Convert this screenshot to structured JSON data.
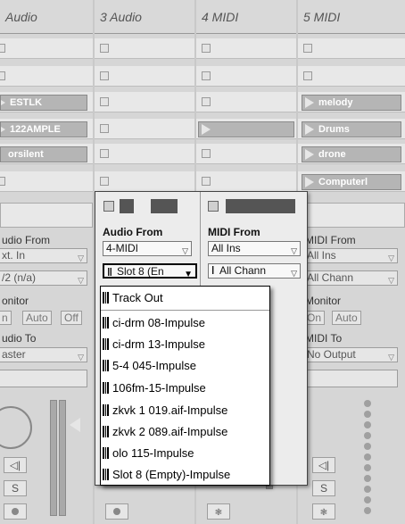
{
  "tracks": [
    {
      "name": "Audio"
    },
    {
      "name": "3 Audio"
    },
    {
      "name": "4 MIDI"
    },
    {
      "name": "5 MIDI"
    }
  ],
  "clips": {
    "col1": [
      "ESTLK",
      "122AMPLE",
      "orsilent"
    ],
    "col4": [
      "melody",
      "Drums",
      "drone",
      "Computerl"
    ]
  },
  "io": {
    "col1": {
      "from_label": "udio From",
      "from_value": "xt. In",
      "channel_value": "/2 (n/a)",
      "monitor_label": "onitor",
      "monitor_buttons": [
        "n",
        "Auto",
        "Off"
      ],
      "to_label": "udio To",
      "to_value": "aster"
    },
    "col4": {
      "from_label": "MIDI From",
      "from_value": "All Ins",
      "channel_value": "All Chann",
      "monitor_label": "Monitor",
      "monitor_buttons": [
        "On",
        "Auto"
      ],
      "to_label": "MIDI To",
      "to_value": "No Output"
    }
  },
  "panel": {
    "audio_from_label": "Audio From",
    "audio_from_value": "4-MIDI",
    "slot_value": "Slot 8 (En",
    "midi_from_label": "MIDI From",
    "midi_from_value": "All Ins",
    "midi_channel_value": "All Chann"
  },
  "menu": {
    "items": [
      "Track Out",
      "ci-drm 08-Impulse",
      "ci-drm 13-Impulse",
      "5-4 045-Impulse",
      "106fm-15-Impulse",
      "zkvk 1 019.aif-Impulse",
      "zkvk 2 089.aif-Impulse",
      "olo 115-Impulse",
      "Slot 8 (Empty)-Impulse"
    ]
  },
  "mixer": {
    "solo_label": "S",
    "speaker_label": "◁|"
  }
}
